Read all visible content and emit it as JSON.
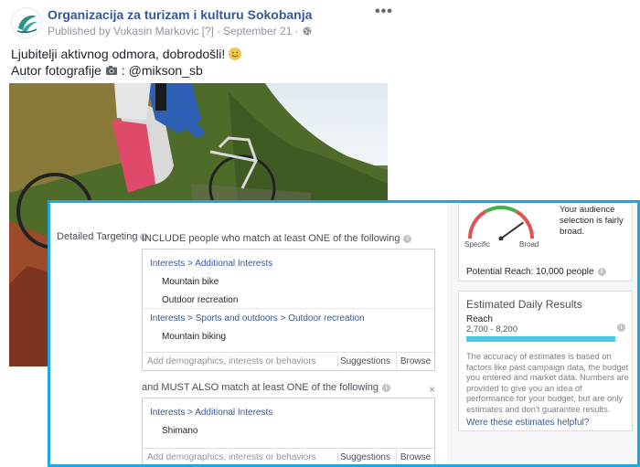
{
  "post": {
    "page_name": "Organizacija za turizam i kulturu Sokobanja",
    "published_by": "Published by Vukasin Markovic",
    "help_mark": "[?]",
    "dot_sep": "·",
    "date": "September 21",
    "more_icon": "more-dots-icon",
    "text_line1": "Ljubitelji aktivnog odmora, dobrodošli!",
    "text_line2_prefix": "Autor fotografije",
    "text_line2_handle": ": @mikson_sb"
  },
  "targeting": {
    "label": "Detailed Targeting",
    "include_header": "INCLUDE people who match at least ONE of the following",
    "groups": [
      {
        "path": "Interests > Additional Interests",
        "items": [
          "Mountain bike",
          "Outdoor recreation"
        ]
      },
      {
        "path": "Interests > Sports and outdoors > Outdoor recreation",
        "items": [
          "Mountain biking"
        ]
      }
    ],
    "add_placeholder": "Add demographics, interests or behaviors",
    "suggestions_label": "Suggestions",
    "browse_label": "Browse",
    "must_header": "and MUST ALSO match at least ONE of the following",
    "close_glyph": "×",
    "must_group": {
      "path": "Interests > Additional Interests",
      "items": [
        "Shimano"
      ]
    }
  },
  "audience": {
    "specific_label": "Specific",
    "broad_label": "Broad",
    "summary": "Your audience selection is fairly broad.",
    "gauge_level": 0.8,
    "potential_reach": "Potential Reach: 10,000 people"
  },
  "estimates": {
    "title": "Estimated Daily Results",
    "reach_label": "Reach",
    "reach_range": "2,700 - 8,200",
    "reach_fill_fraction": 0.98,
    "disclaimer": "The accuracy of estimates is based on factors like past campaign data, the budget you entered and market data. Numbers are provided to give you an idea of performance for your budget, but are only estimates and don't guarantee results.",
    "helpful_link": "Were these estimates helpful?"
  },
  "colors": {
    "accent_border": "#1da7e4",
    "link_blue": "#365899",
    "reach_bar": "#4cc8e6"
  }
}
